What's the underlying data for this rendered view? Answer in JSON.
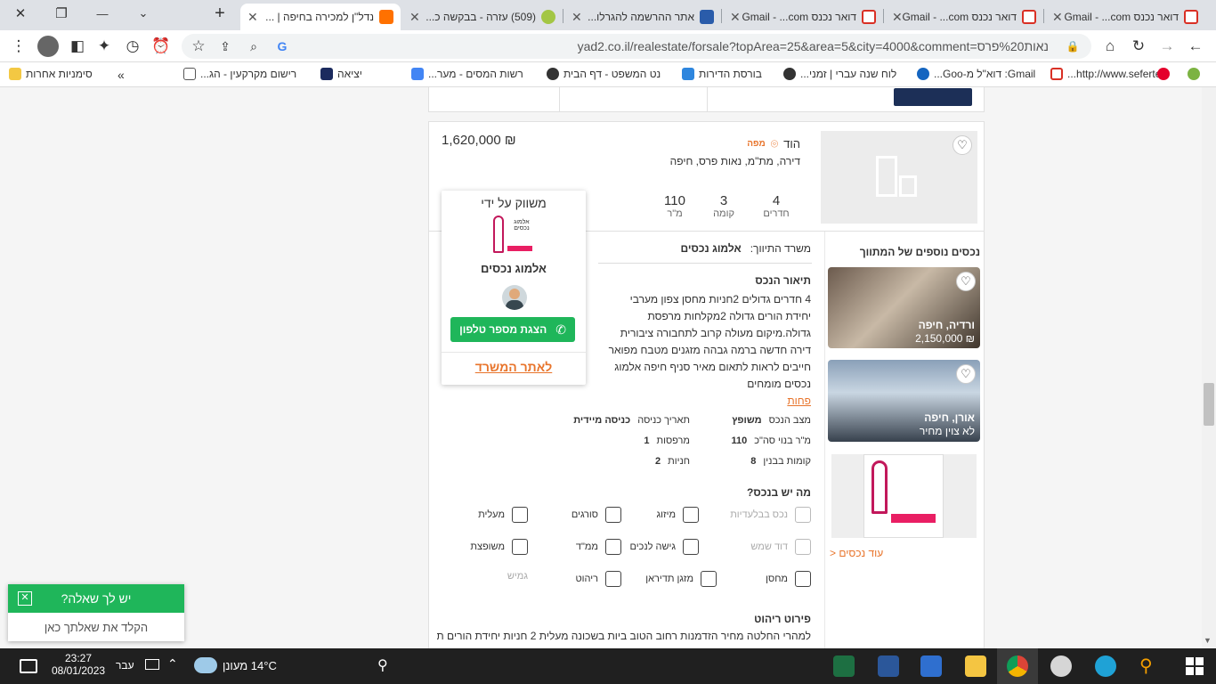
{
  "browser": {
    "tabs": [
      {
        "title": "נדל\"ן למכירה בחיפה | ...",
        "active": true
      },
      {
        "title": "(509) עזרה - בבקשה כ..."
      },
      {
        "title": "אתר ההרשמה להגרלו..."
      },
      {
        "title": "דואר נכנס Gmail - ...com"
      },
      {
        "title": "דואר נכנס Gmail - ...com"
      },
      {
        "title": "דואר נכנס Gmail - ...com"
      }
    ],
    "url": "yad2.co.il/realestate/forsale?topArea=25&area=5&city=4000&comment=נאות%20פרס",
    "bookmarks": [
      "http://www.sefertek...",
      "Gmail: דוא\"ל מ-Goo...",
      "לוח שנה עברי | זמני...",
      "בורסת הדירות",
      "נט המשפט - דף הבית",
      "רשות המסים - מער...",
      "יציאה",
      "רישום מקרקעין - הג...",
      "סימניות אחרות"
    ]
  },
  "listing": {
    "price": "₪ 1,620,000",
    "property_type": "הוד",
    "map_label": "מפה",
    "subtitle": "דירה, מת\"מ, נאות פרס, חיפה",
    "stats": [
      {
        "value": "4",
        "label": "חדרים"
      },
      {
        "value": "3",
        "label": "קומה"
      },
      {
        "value": "110",
        "label": "מ\"ר"
      }
    ]
  },
  "agency_card": {
    "title": "משווק על ידי",
    "logo_text": "אלמוג נכסים",
    "name": "אלמוג נכסים",
    "phone_button": "הצגת מספר טלפון",
    "site_link": "לאתר המשרד"
  },
  "details": {
    "brokerage_label": "משרד התיווך:",
    "brokerage_name": "אלמוג נכסים",
    "desc_title": "תיאור הנכס",
    "desc_lines": [
      "4 חדרים גדולים 2חניות מחסן צפון מערבי",
      "יחידת הורים גדולה 2מקלחות מרפסת",
      "גדולה.מיקום מעולה קרוב לתחבורה ציבורית",
      "דירה חדשה ברמה גבהה מזגנים מטבח מפואר",
      "חייבים לראות לתאום מאיר סניף חיפה אלמוג",
      "נכסים מומחים"
    ],
    "more_link": "פחות",
    "specs": [
      {
        "label": "מצב הנכס",
        "value": "משופץ"
      },
      {
        "label": "תאריך כניסה",
        "value": "כניסה מיידית"
      },
      {
        "label": "מ\"ר בנוי סה\"כ",
        "value": "110"
      },
      {
        "label": "מרפסות",
        "value": "1"
      },
      {
        "label": "קומות בבנין",
        "value": "8"
      },
      {
        "label": "חניות",
        "value": "2"
      }
    ],
    "features_title": "מה יש בנכס?",
    "features": [
      {
        "label": "נכס בבלעדיות",
        "enabled": false,
        "icon": "diamond-icon"
      },
      {
        "label": "מיזוג",
        "enabled": true,
        "icon": "snowflake-icon"
      },
      {
        "label": "סורגים",
        "enabled": true,
        "icon": "grid-icon"
      },
      {
        "label": "מעלית",
        "enabled": true,
        "icon": "elevator-icon"
      },
      {
        "label": "דוד שמש",
        "enabled": false,
        "icon": "solar-icon"
      },
      {
        "label": "גישה לנכים",
        "enabled": true,
        "icon": "wheelchair-icon"
      },
      {
        "label": "ממ\"ד",
        "enabled": true,
        "icon": "shield-box-icon"
      },
      {
        "label": "משופצת",
        "enabled": true,
        "icon": "paint-roller-icon"
      },
      {
        "label": "מחסן",
        "enabled": true,
        "icon": "box-icon"
      },
      {
        "label": "מזגן תדיראן",
        "enabled": true,
        "icon": "ac-icon"
      },
      {
        "label": "ריהוט",
        "enabled": true,
        "icon": "furniture-icon"
      },
      {
        "label": "גמיש",
        "enabled": false,
        "icon": "flex-icon"
      }
    ],
    "furniture_title": "פירוט ריהוט",
    "furniture_text": "למהרי החלטה מחיר הזדמנות רחוב הטוב ביות בשכונה מעלית 2 חניות יחידת הורים תכנון"
  },
  "sidebar": {
    "title": "נכסים נוספים של המתווך",
    "items": [
      {
        "place": "ורדיה, חיפה",
        "price": "₪ 2,150,000"
      },
      {
        "place": "אורן, חיפה",
        "price": "לא צוין מחיר"
      }
    ],
    "more_link": "עוד נכסים <"
  },
  "chat_widget": {
    "title": "יש לך שאלה?",
    "placeholder": "הקלד את שאלתך כאן"
  },
  "taskbar": {
    "time": "23:27",
    "date": "08/01/2023",
    "lang": "עבר",
    "weather": "14°C  מעונן"
  },
  "colors": {
    "accent_green": "#1fb65a",
    "link_orange": "#e8742b",
    "taskbar": "#202020"
  }
}
